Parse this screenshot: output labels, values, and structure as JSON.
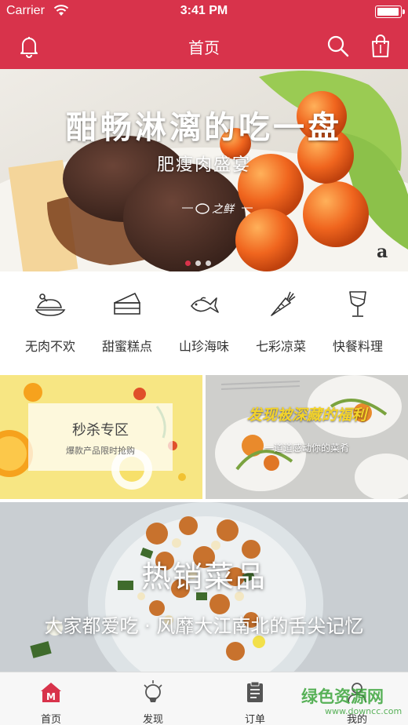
{
  "status_bar": {
    "carrier": "Carrier",
    "time": "3:41 PM",
    "battery_level": 1.0
  },
  "nav": {
    "title": "首页",
    "icons": [
      "bell-icon",
      "search-icon",
      "shopping-bag-icon"
    ]
  },
  "hero": {
    "title": "酣畅淋漓的吃一盘",
    "subtitle": "肥瘦肉盛宴",
    "logo_text": "之鲜",
    "page_count": 3,
    "active_page": 1
  },
  "categories": [
    {
      "label": "无肉不欢",
      "icon": "chicken-icon"
    },
    {
      "label": "甜蜜糕点",
      "icon": "cake-icon"
    },
    {
      "label": "山珍海味",
      "icon": "fish-icon"
    },
    {
      "label": "七彩凉菜",
      "icon": "carrot-icon"
    },
    {
      "label": "快餐料理",
      "icon": "wine-glass-icon"
    }
  ],
  "promos": {
    "flash_sale": {
      "title": "秒杀专区",
      "subtitle": "爆款产品限时抢购"
    },
    "discover": {
      "title": "发现被深藏的福利",
      "subtitle": "一道道感动你的菜肴"
    }
  },
  "hot": {
    "title": "热销菜品",
    "subtitle": "大家都爱吃 · 风靡大江南北的舌尖记忆"
  },
  "tabs": [
    {
      "label": "首页",
      "icon": "home-icon",
      "active": true
    },
    {
      "label": "发现",
      "icon": "discover-icon",
      "active": false
    },
    {
      "label": "订单",
      "icon": "order-icon",
      "active": false
    },
    {
      "label": "我的",
      "icon": "profile-icon",
      "active": false
    }
  ],
  "watermark": {
    "name": "绿色资源网",
    "url": "www.downcc.com"
  },
  "colors": {
    "brand": "#d8334b",
    "tab_active": "#d8334b",
    "watermark": "#3da53d"
  }
}
